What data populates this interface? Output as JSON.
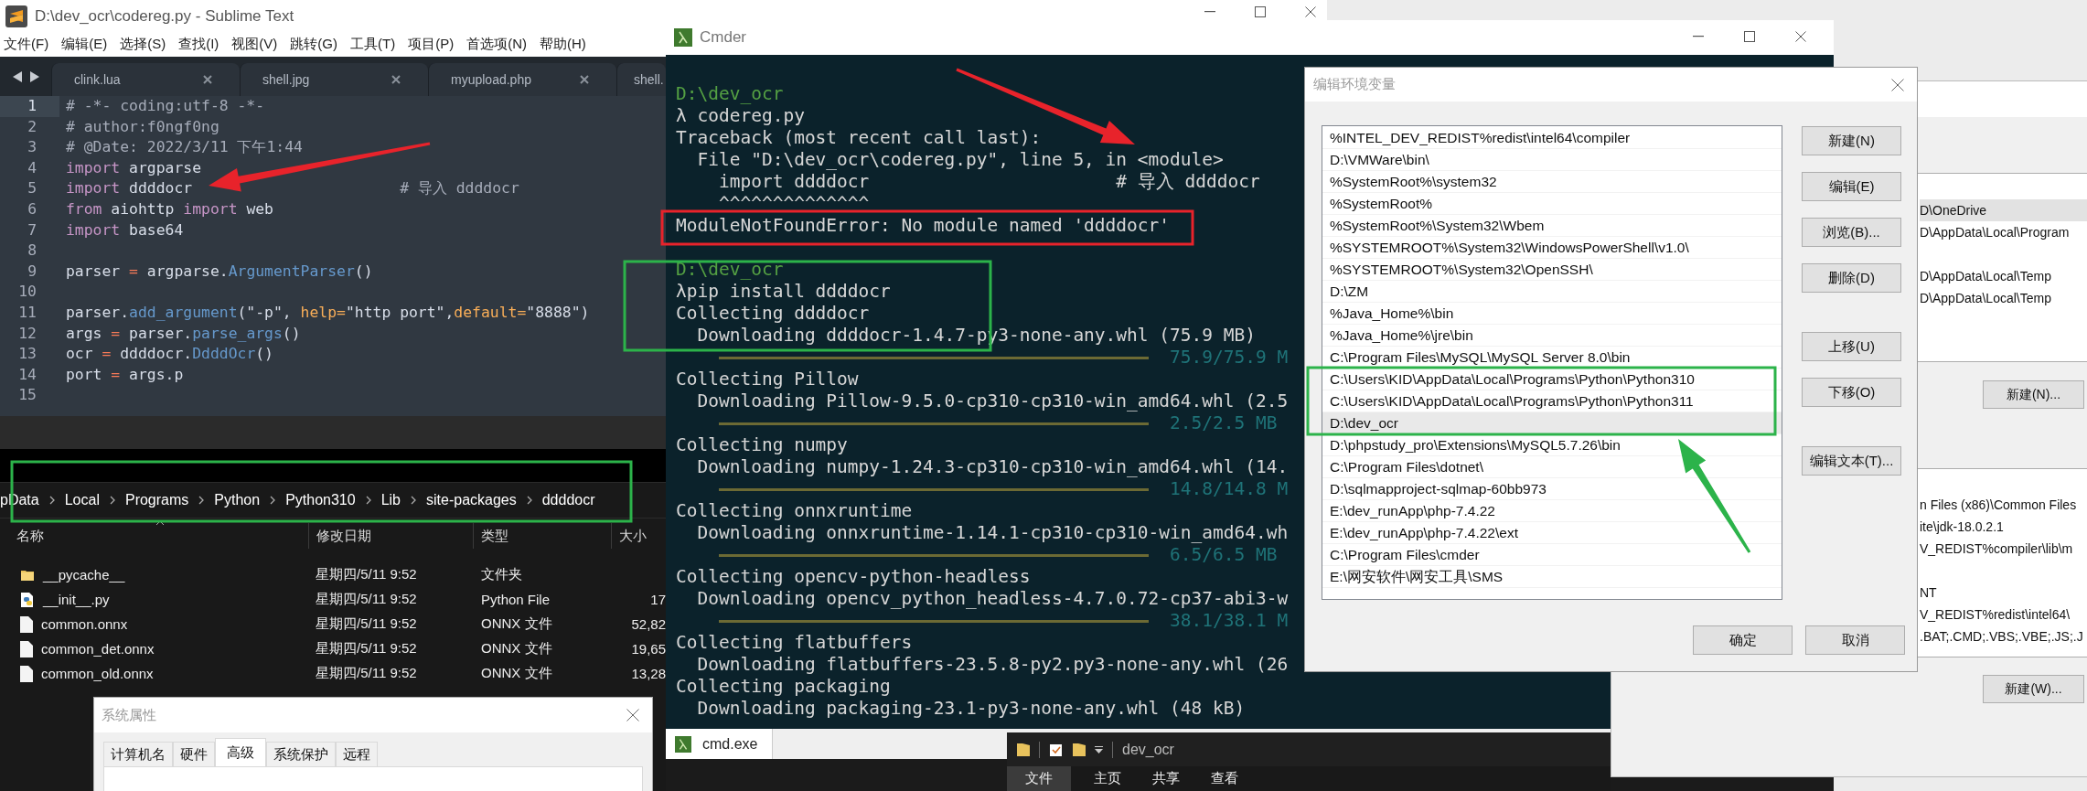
{
  "sublime": {
    "title": "D:\\dev_ocr\\codereg.py - Sublime Text",
    "menu": [
      "文件(F)",
      "编辑(E)",
      "选择(S)",
      "查找(I)",
      "视图(V)",
      "跳转(G)",
      "工具(T)",
      "项目(P)",
      "首选项(N)",
      "帮助(H)"
    ],
    "tabs": [
      "clink.lua",
      "shell.jpg",
      "myupload.php",
      "shell."
    ],
    "lines": [
      {
        "number": "1",
        "current": true,
        "tokens": [
          {
            "kind": "comment",
            "text": "# -*- coding:utf-8 -*-"
          }
        ]
      },
      {
        "number": "2",
        "current": false,
        "tokens": [
          {
            "kind": "comment",
            "text": "# author:f0ngf0ng"
          }
        ]
      },
      {
        "number": "3",
        "current": false,
        "tokens": [
          {
            "kind": "comment",
            "text": "# @Date: 2022/3/11 下午1:44"
          }
        ]
      },
      {
        "number": "4",
        "current": false,
        "tokens": [
          {
            "kind": "keyword",
            "text": "import"
          },
          {
            "kind": "plain",
            "text": " argparse"
          }
        ]
      },
      {
        "number": "5",
        "current": false,
        "tokens": [
          {
            "kind": "keyword",
            "text": "import"
          },
          {
            "kind": "plain",
            "text": " ddddocr                       "
          },
          {
            "kind": "comment",
            "text": "# 导入 ddddocr"
          }
        ]
      },
      {
        "number": "6",
        "current": false,
        "tokens": [
          {
            "kind": "keyword",
            "text": "from"
          },
          {
            "kind": "plain",
            "text": " aiohttp "
          },
          {
            "kind": "keyword",
            "text": "import"
          },
          {
            "kind": "plain",
            "text": " web"
          }
        ]
      },
      {
        "number": "7",
        "current": false,
        "tokens": [
          {
            "kind": "keyword",
            "text": "import"
          },
          {
            "kind": "plain",
            "text": " base64"
          }
        ]
      },
      {
        "number": "8",
        "current": false
      },
      {
        "number": "9",
        "current": false,
        "tokens": [
          {
            "kind": "plain",
            "text": "parser "
          },
          {
            "kind": "operator",
            "text": "="
          },
          {
            "kind": "plain",
            "text": " argparse."
          },
          {
            "kind": "function",
            "text": "ArgumentParser"
          },
          {
            "kind": "plain",
            "text": "()"
          }
        ]
      },
      {
        "number": "10",
        "current": false
      },
      {
        "number": "11",
        "current": false,
        "tokens": [
          {
            "kind": "plain",
            "text": "parser."
          },
          {
            "kind": "function",
            "text": "add_argument"
          },
          {
            "kind": "plain",
            "text": "(\"-p\", "
          },
          {
            "kind": "parameter",
            "text": "help="
          },
          {
            "kind": "plain",
            "text": "\"http port\","
          },
          {
            "kind": "parameter",
            "text": "default="
          },
          {
            "kind": "plain",
            "text": "\"8888\")"
          }
        ]
      },
      {
        "number": "12",
        "current": false,
        "tokens": [
          {
            "kind": "plain",
            "text": "args "
          },
          {
            "kind": "operator",
            "text": "="
          },
          {
            "kind": "plain",
            "text": " parser."
          },
          {
            "kind": "function",
            "text": "parse_args"
          },
          {
            "kind": "plain",
            "text": "()"
          }
        ]
      },
      {
        "number": "13",
        "current": false,
        "tokens": [
          {
            "kind": "plain",
            "text": "ocr "
          },
          {
            "kind": "operator",
            "text": "="
          },
          {
            "kind": "plain",
            "text": " ddddocr."
          },
          {
            "kind": "function",
            "text": "DdddOcr"
          },
          {
            "kind": "plain",
            "text": "()"
          }
        ]
      },
      {
        "number": "14",
        "current": false,
        "tokens": [
          {
            "kind": "plain",
            "text": "port "
          },
          {
            "kind": "operator",
            "text": "="
          },
          {
            "kind": "plain",
            "text": " args.p"
          }
        ]
      },
      {
        "number": "15",
        "current": false
      }
    ]
  },
  "explorer": {
    "breadcrumb": [
      "pData",
      "Local",
      "Programs",
      "Python",
      "Python310",
      "Lib",
      "site-packages",
      "ddddocr"
    ],
    "columns": [
      "名称",
      "修改日期",
      "类型",
      "大小"
    ],
    "files": [
      {
        "kind": "folder",
        "name": "__pycache__",
        "modified": "星期四/5/11 9:52",
        "type": "文件夹"
      },
      {
        "kind": "python",
        "name": "__init__.py",
        "modified": "星期四/5/11 9:52",
        "type": "Python File",
        "size": "17"
      },
      {
        "kind": "file",
        "name": "common.onnx",
        "modified": "星期四/5/11 9:52",
        "type": "ONNX 文件",
        "size": "52,82"
      },
      {
        "kind": "file",
        "name": "common_det.onnx",
        "modified": "星期四/5/11 9:52",
        "type": "ONNX 文件",
        "size": "19,65"
      },
      {
        "kind": "file",
        "name": "common_old.onnx",
        "modified": "星期四/5/11 9:52",
        "type": "ONNX 文件",
        "size": "13,28"
      }
    ]
  },
  "system_properties": {
    "title": "系统属性",
    "tabs": [
      {
        "label": "计算机名",
        "selected": false
      },
      {
        "label": "硬件",
        "selected": false
      },
      {
        "label": "高级",
        "selected": true
      },
      {
        "label": "系统保护",
        "selected": false
      },
      {
        "label": "远程",
        "selected": false
      }
    ]
  },
  "cmder": {
    "title": "Cmder",
    "tab": "cmd.exe",
    "lines": [
      {
        "kind": "path",
        "text": "D:\\dev_ocr"
      },
      {
        "kind": "text",
        "text": "λ codereg.py"
      },
      {
        "kind": "text",
        "text": "Traceback (most recent call last):"
      },
      {
        "kind": "text",
        "text": "  File \"D:\\dev_ocr\\codereg.py\", line 5, in <module>"
      },
      {
        "kind": "text",
        "text": "    import ddddocr                       # 导入 ddddocr"
      },
      {
        "kind": "text",
        "text": "    ^^^^^^^^^^^^^^"
      },
      {
        "kind": "text",
        "text": "ModuleNotFoundError: No module named 'ddddocr'"
      },
      {
        "kind": "blank"
      },
      {
        "kind": "path",
        "text": "D:\\dev_ocr"
      },
      {
        "kind": "text",
        "text": "λpip install ddddocr"
      },
      {
        "kind": "text",
        "text": "Collecting ddddocr"
      },
      {
        "kind": "text",
        "text": "  Downloading ddddocr-1.4.7-py3-none-any.whl (75.9 MB)"
      },
      {
        "kind": "progress",
        "level": 1,
        "reading": "75.9/75.9 M"
      },
      {
        "kind": "text",
        "text": "Collecting Pillow"
      },
      {
        "kind": "text",
        "text": "  Downloading Pillow-9.5.0-cp310-cp310-win_amd64.whl (2.5"
      },
      {
        "kind": "progress",
        "level": 1,
        "reading": "2.5/2.5 MB"
      },
      {
        "kind": "text",
        "text": "Collecting numpy"
      },
      {
        "kind": "text",
        "text": "  Downloading numpy-1.24.3-cp310-cp310-win_amd64.whl (14."
      },
      {
        "kind": "progress",
        "level": 1,
        "reading": "14.8/14.8 M"
      },
      {
        "kind": "text",
        "text": "Collecting onnxruntime"
      },
      {
        "kind": "text",
        "text": "  Downloading onnxruntime-1.14.1-cp310-cp310-win_amd64.wh"
      },
      {
        "kind": "progress",
        "level": 1,
        "reading": "6.5/6.5 MB"
      },
      {
        "kind": "text",
        "text": "Collecting opencv-python-headless"
      },
      {
        "kind": "text",
        "text": "  Downloading opencv_python_headless-4.7.0.72-cp37-abi3-w"
      },
      {
        "kind": "progress",
        "level": 1,
        "reading": "38.1/38.1 M"
      },
      {
        "kind": "text",
        "text": "Collecting flatbuffers"
      },
      {
        "kind": "text",
        "text": "  Downloading flatbuffers-23.5.8-py2.py3-none-any.whl (26"
      },
      {
        "kind": "text",
        "text": "Collecting packaging"
      },
      {
        "kind": "text",
        "text": "  Downloading packaging-23.1-py3-none-any.whl (48 kB)"
      }
    ]
  },
  "environment_variables": {
    "user_rows": [
      {
        "kind": "entry",
        "text": "D\\OneDrive",
        "selected": true
      },
      {
        "kind": "entry",
        "text": "D\\AppData\\Local\\Program",
        "selected": false
      },
      {
        "kind": "blank"
      },
      {
        "kind": "entry",
        "text": "D\\AppData\\Local\\Temp",
        "selected": false
      },
      {
        "kind": "entry",
        "text": "D\\AppData\\Local\\Temp",
        "selected": false
      }
    ],
    "user_button": "新建(N)...",
    "system_rows": [
      {
        "kind": "entry",
        "text": "n Files (x86)\\Common Files"
      },
      {
        "kind": "entry",
        "text": "ite\\jdk-18.0.2.1"
      },
      {
        "kind": "entry",
        "text": "V_REDIST%compiler\\lib\\m"
      },
      {
        "kind": "blank"
      },
      {
        "kind": "entry",
        "text": "NT"
      },
      {
        "kind": "entry",
        "text": "V_REDIST%redist\\intel64\\"
      },
      {
        "kind": "entry",
        "text": ".BAT;.CMD;.VBS;.VBE;.JS;.J"
      }
    ],
    "system_button": "新建(W)..."
  },
  "edit_dialog": {
    "title": "编辑环境变量",
    "entries": [
      {
        "text": "%INTEL_DEV_REDIST%redist\\intel64\\compiler",
        "selected": false
      },
      {
        "text": "D:\\VMWare\\bin\\",
        "selected": false
      },
      {
        "text": "%SystemRoot%\\system32",
        "selected": false
      },
      {
        "text": "%SystemRoot%",
        "selected": false
      },
      {
        "text": "%SystemRoot%\\System32\\Wbem",
        "selected": false
      },
      {
        "text": "%SYSTEMROOT%\\System32\\WindowsPowerShell\\v1.0\\",
        "selected": false
      },
      {
        "text": "%SYSTEMROOT%\\System32\\OpenSSH\\",
        "selected": false
      },
      {
        "text": "D:\\ZM",
        "selected": false
      },
      {
        "text": "%Java_Home%\\bin",
        "selected": false
      },
      {
        "text": "%Java_Home%\\jre\\bin",
        "selected": false
      },
      {
        "text": "C:\\Program Files\\MySQL\\MySQL Server 8.0\\bin",
        "selected": false
      },
      {
        "text": "C:\\Users\\KID\\AppData\\Local\\Programs\\Python\\Python310",
        "selected": false
      },
      {
        "text": "C:\\Users\\KID\\AppData\\Local\\Programs\\Python\\Python311",
        "selected": false
      },
      {
        "text": "D:\\dev_ocr",
        "selected": true
      },
      {
        "text": "D:\\phpstudy_pro\\Extensions\\MySQL5.7.26\\bin",
        "selected": false
      },
      {
        "text": "C:\\Program Files\\dotnet\\",
        "selected": false
      },
      {
        "text": "D:\\sqlmapproject-sqlmap-60bb973",
        "selected": false
      },
      {
        "text": "E:\\dev_runApp\\php-7.4.22",
        "selected": false
      },
      {
        "text": "E:\\dev_runApp\\php-7.4.22\\ext",
        "selected": false
      },
      {
        "text": "C:\\Program Files\\cmder",
        "selected": false
      },
      {
        "text": "E:\\网安软件\\网安工具\\SMS",
        "selected": false
      }
    ],
    "button_groups": [
      [
        "新建(N)",
        "编辑(E)",
        "浏览(B)...",
        "删除(D)"
      ],
      [
        "上移(U)",
        "下移(O)"
      ],
      [
        "编辑文本(T)..."
      ]
    ],
    "footer_buttons": [
      "确定",
      "取消"
    ]
  },
  "folder_window": {
    "title": "dev_ocr",
    "ribbon_tabs": [
      {
        "label": "文件",
        "selected": true
      },
      {
        "label": "主页",
        "selected": false
      },
      {
        "label": "共享",
        "selected": false
      },
      {
        "label": "查看",
        "selected": false
      }
    ]
  },
  "annotations": [
    {
      "kind": "arrow",
      "color": "#e8232b"
    },
    {
      "kind": "arrow",
      "color": "#e8232b"
    },
    {
      "kind": "frame",
      "color": "#e8232b"
    },
    {
      "kind": "frame",
      "color": "#2cb34a"
    },
    {
      "kind": "frame",
      "color": "#2cb34a"
    },
    {
      "kind": "frame",
      "color": "#2cb34a"
    },
    {
      "kind": "arrow",
      "color": "#2cb34a"
    }
  ]
}
